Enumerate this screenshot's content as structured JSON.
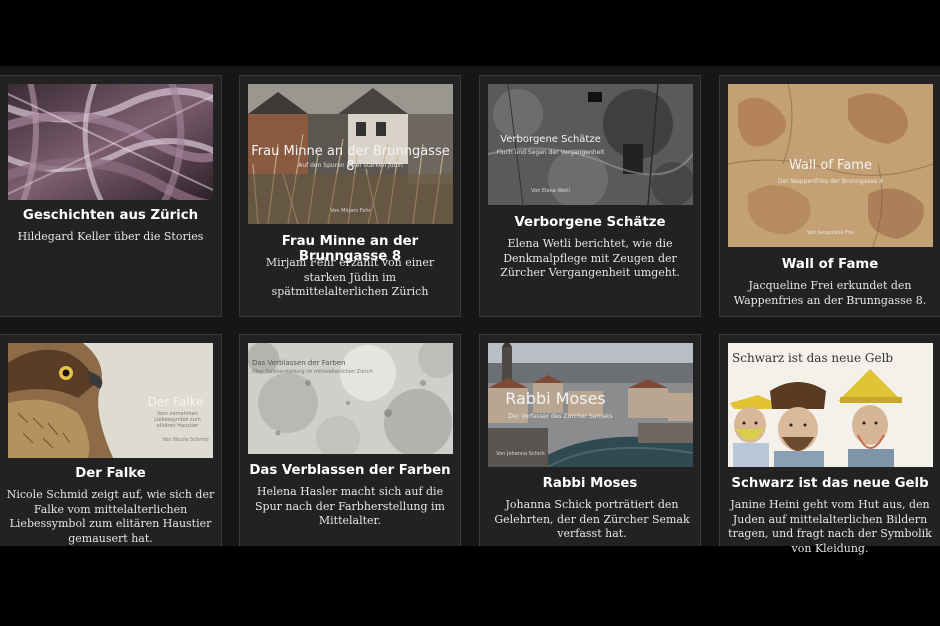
{
  "cards": [
    {
      "title": "Geschichten aus Zürich",
      "desc": "Hildegard Keller über die Stories",
      "overlay": null
    },
    {
      "title": "Frau Minne an der Brunngasse 8",
      "desc": "Mirjam Fehr erzählt von einer starken Jüdin im spätmittelalterlichen Zürich",
      "overlay": {
        "title": "Frau Minne an der Brunngasse 8",
        "subtitle": "Auf den Spuren einer starken Jüdin",
        "byline": "Von Mirjam Fehr"
      }
    },
    {
      "title": "Verborgene Schätze",
      "desc": "Elena Wetli berichtet, wie die Denkmalpflege mit Zeugen der Zürcher Vergangenheit umgeht.",
      "overlay": {
        "title": "Verborgene Schätze",
        "subtitle": "Fluch und Segen der Vergangenheit",
        "byline": "Von Elena Wetli"
      }
    },
    {
      "title": "Wall of Fame",
      "desc": "Jacqueline Frei erkundet den Wappenfries an der Brunngasse 8.",
      "overlay": {
        "title": "Wall of Fame",
        "subtitle": "Der Wappenfries der Brunngasse 8",
        "byline": "Von Jacqueline Frei"
      }
    },
    {
      "title": "Der Falke",
      "desc": "Nicole Schmid zeigt auf, wie sich der Falke vom mittelalterlichen Liebessymbol zum elitären Haustier gemausert hat.",
      "overlay": {
        "title": "Der Falke",
        "subtitle": "Vom vornehmen Liebessymbol zum elitären Haustier",
        "byline": "Von Nicole Schmid"
      }
    },
    {
      "title": "Das Verblassen der Farben",
      "desc": "Helena Hasler macht sich auf die Spur nach der Farbherstellung im Mittelalter.",
      "overlay": {
        "title": "Das Verblassen der Farben",
        "subtitle": "Über Farbherstellung im mittelalterlichen Zürich",
        "byline": ""
      }
    },
    {
      "title": "Rabbi Moses",
      "desc": "Johanna Schick porträtiert den Gelehrten, der den Zürcher Semak verfasst hat.",
      "overlay": {
        "title": "Rabbi Moses",
        "subtitle": "Der Verfasser des Zürcher Semaks",
        "byline": "Von Johanna Schick"
      }
    },
    {
      "title": "Schwarz ist das neue Gelb",
      "desc": "Janine Heini geht vom Hut aus, den Juden auf mittelalterlichen Bildern tragen, und fragt nach der Symbolik von Kleidung.",
      "overlay": {
        "title": "Schwarz ist das neue Gelb",
        "subtitle": "",
        "byline": ""
      }
    }
  ]
}
